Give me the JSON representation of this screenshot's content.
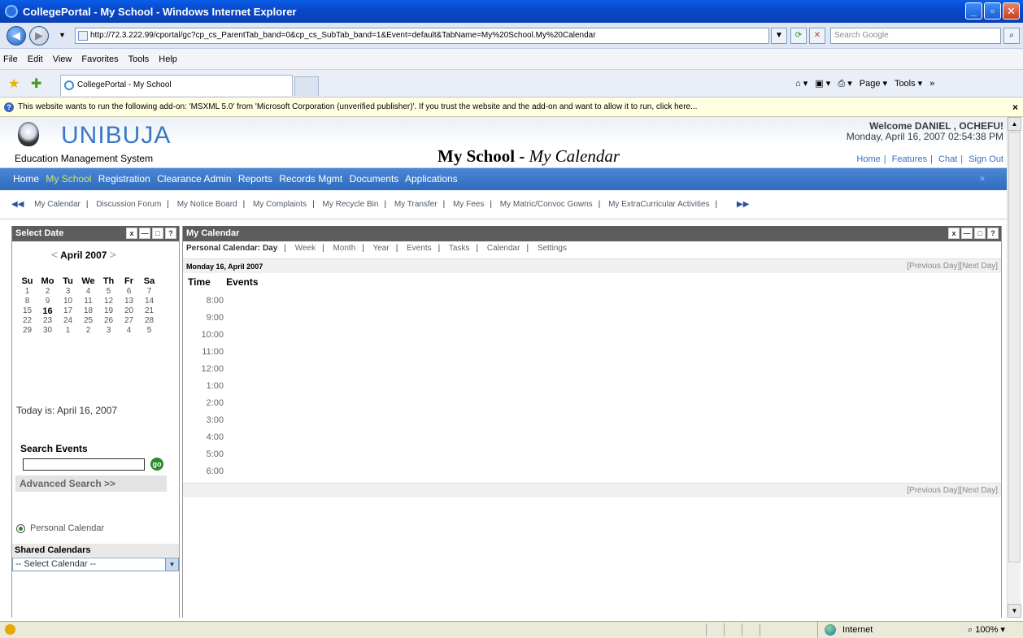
{
  "window": {
    "title": "CollegePortal - My School - Windows Internet Explorer",
    "minimize": "_",
    "maximize": "▫",
    "close": "✕"
  },
  "addressbar": {
    "url": "http://72.3.222.99/cportal/gc?cp_cs_ParentTab_band=0&cp_cs_SubTab_band=1&Event=default&TabName=My%20School.My%20Calendar",
    "search_placeholder": "Search Google"
  },
  "menubar": [
    "File",
    "Edit",
    "View",
    "Favorites",
    "Tools",
    "Help"
  ],
  "tabs": {
    "active_tab": "CollegePortal - My School"
  },
  "commandbar": {
    "page": "Page ▾",
    "tools": "Tools ▾"
  },
  "infobar": {
    "text": "This website wants to run the following add-on: 'MSXML 5.0' from 'Microsoft Corporation (unverified publisher)'. If you trust the website and the add-on and want to allow it to run, click here...",
    "close": "×"
  },
  "header": {
    "brand": "UNIBUJA",
    "subtitle": "Education Management System",
    "page_title_main": "My School",
    "page_title_sep": " - ",
    "page_title_sub": "My Calendar",
    "welcome": "Welcome DANIEL , OCHEFU!",
    "datetime": "Monday, April 16, 2007 02:54:38 PM",
    "links": [
      "Home",
      "Features",
      "Chat",
      "Sign Out"
    ]
  },
  "mainnav": {
    "items": [
      "Home",
      "My School",
      "Registration",
      "Clearance Admin",
      "Reports",
      "Records Mgmt",
      "Documents",
      "Applications"
    ],
    "active": "My School",
    "more": "»"
  },
  "subnav": {
    "items": [
      "My Calendar",
      "Discussion Forum",
      "My Notice Board",
      "My Complaints",
      "My Recycle Bin",
      "My Transfer",
      "My Fees",
      "My Matric/Convoc Gowns",
      "My ExtraCurricular Activities"
    ]
  },
  "left_panel": {
    "title": "Select Date",
    "month_label": "April 2007",
    "weekdays": [
      "Su",
      "Mo",
      "Tu",
      "We",
      "Th",
      "Fr",
      "Sa"
    ],
    "weeks": [
      [
        "1",
        "2",
        "3",
        "4",
        "5",
        "6",
        "7"
      ],
      [
        "8",
        "9",
        "10",
        "11",
        "12",
        "13",
        "14"
      ],
      [
        "15",
        "16",
        "17",
        "18",
        "19",
        "20",
        "21"
      ],
      [
        "22",
        "23",
        "24",
        "25",
        "26",
        "27",
        "28"
      ],
      [
        "29",
        "30",
        "1",
        "2",
        "3",
        "4",
        "5"
      ]
    ],
    "today_day": "16",
    "today_text": "Today is: April 16, 2007",
    "search_label": "Search Events",
    "go_label": "go",
    "advanced_search": "Advanced Search >>",
    "personal_calendar": "Personal Calendar",
    "shared_calendars": "Shared Calendars",
    "select_calendar": "-- Select Calendar --"
  },
  "main_panel": {
    "title": "My Calendar",
    "calendar_label": "Personal Calendar:",
    "views": [
      "Day",
      "Week",
      "Month",
      "Year",
      "Events",
      "Tasks",
      "Calendar",
      "Settings"
    ],
    "active_view": "Day",
    "date_header": "Monday 16, April 2007",
    "prev_next": "[Previous Day][Next Day]",
    "col_time": "Time",
    "col_events": "Events",
    "times": [
      "8:00",
      "9:00",
      "10:00",
      "11:00",
      "12:00",
      "1:00",
      "2:00",
      "3:00",
      "4:00",
      "5:00",
      "6:00"
    ]
  },
  "statusbar": {
    "zone": "Internet",
    "zoom": "100%"
  }
}
